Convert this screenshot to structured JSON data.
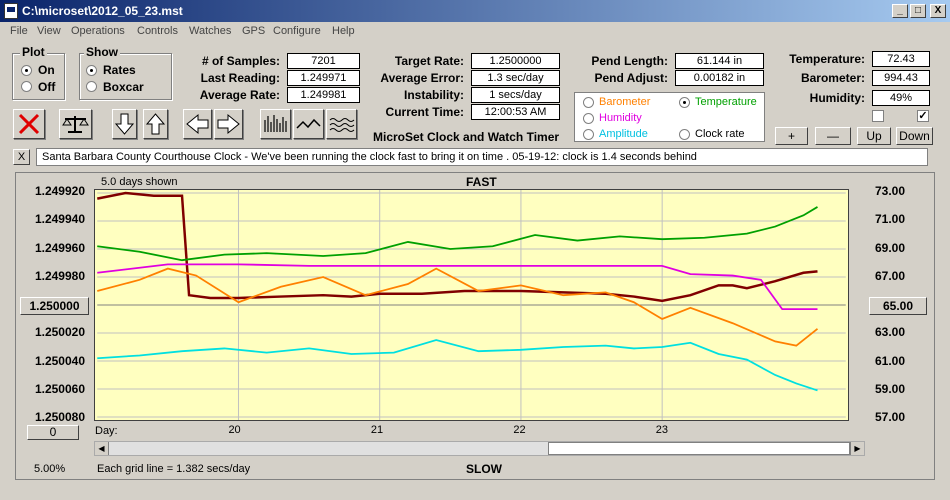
{
  "title": "C:\\microset\\2012_05_23.mst",
  "window_controls": {
    "minimize": "_",
    "maximize": "□",
    "close": "X"
  },
  "menu": [
    "File",
    "View",
    "Operations",
    "Controls",
    "Watches",
    "GPS",
    "Configure",
    "Help"
  ],
  "plot_group": {
    "label": "Plot",
    "on": "On",
    "off": "Off",
    "selected": "On"
  },
  "show_group": {
    "label": "Show",
    "rates": "Rates",
    "boxcar": "Boxcar",
    "selected": "Rates"
  },
  "stats": {
    "samples_label": "# of Samples:",
    "samples": "7201",
    "last_reading_label": "Last Reading:",
    "last_reading": "1.249971",
    "average_rate_label": "Average Rate:",
    "average_rate": "1.249981",
    "target_rate_label": "Target Rate:",
    "target_rate": "1.2500000",
    "average_error_label": "Average Error:",
    "average_error": "1.3 sec/day",
    "instability_label": "Instability:",
    "instability": "1 secs/day",
    "current_time_label": "Current Time:",
    "current_time": "12:00:53 AM",
    "pend_length_label": "Pend Length:",
    "pend_length": "61.144 in",
    "pend_adjust_label": "Pend Adjust:",
    "pend_adjust": "0.00182 in",
    "temperature_label": "Temperature:",
    "temperature": "72.43",
    "barometer_label": "Barometer:",
    "barometer": "994.43",
    "humidity_label": "Humidity:",
    "humidity": "49%"
  },
  "app_name": "MicroSet Clock and Watch Timer",
  "select_options": {
    "barometer": "Barometer",
    "temperature": "Temperature",
    "humidity": "Humidity",
    "amplitude": "Amplitude",
    "clock_rate": "Clock rate",
    "selected": "Temperature"
  },
  "right_buttons": {
    "plus": "+",
    "minus": "—",
    "up": "Up",
    "down": "Down"
  },
  "checkboxes": {
    "left": false,
    "right": true
  },
  "note": {
    "close": "X",
    "text": "Santa Barbara County Courthouse Clock - We've been running the clock fast to bring it on time .   05-19-12: clock is 1.4 seconds behind"
  },
  "graph": {
    "days_shown": "5.0 days shown",
    "top_label": "FAST",
    "bottom_label": "SLOW",
    "grid_note": "Each grid line = 1.382 secs/day",
    "percent": "5.00%",
    "left_center_button": "1.250000",
    "right_center_button": "65.00",
    "zero_button": "0",
    "day_label": "Day:"
  },
  "chart_data": {
    "type": "line",
    "title": "",
    "ylabel_left": "",
    "ylabel_right": "",
    "ylim_left": [
      1.25008,
      1.24992
    ],
    "ylim_right": [
      57.0,
      73.0
    ],
    "y_left_ticks": [
      "1.249920",
      "1.249940",
      "1.249960",
      "1.249980",
      "1.250000",
      "1.250020",
      "1.250040",
      "1.250060",
      "1.250080"
    ],
    "y_right_ticks": [
      "73.00",
      "71.00",
      "69.00",
      "67.00",
      "65.00",
      "63.00",
      "61.00",
      "59.00",
      "57.00"
    ],
    "x_ticks": [
      {
        "day": 20,
        "pos": 1.0
      },
      {
        "day": 21,
        "pos": 2.0
      },
      {
        "day": 22,
        "pos": 3.0
      },
      {
        "day": 23,
        "pos": 4.0
      }
    ],
    "xlim": [
      0.0,
      5.3
    ],
    "colors": {
      "rate": "#800000",
      "temperature": "#00a000",
      "humidity": "#e000e0",
      "barometer": "#ff8000",
      "amplitude": "#00e0e0"
    },
    "series": [
      {
        "name": "Clock rate",
        "color": "#800000",
        "axis": "left",
        "x": [
          0.0,
          0.2,
          0.4,
          0.6,
          0.62,
          0.65,
          0.8,
          1.0,
          1.3,
          1.6,
          1.8,
          2.0,
          2.3,
          2.6,
          3.0,
          3.3,
          3.6,
          3.8,
          4.0,
          4.2,
          4.4,
          4.5,
          4.6,
          4.8,
          5.0,
          5.1
        ],
        "y": [
          1.249924,
          1.24992,
          1.249922,
          1.249922,
          1.24995,
          1.249993,
          1.249995,
          1.249995,
          1.249994,
          1.249993,
          1.249994,
          1.249992,
          1.249992,
          1.24999,
          1.24999,
          1.249991,
          1.249992,
          1.249994,
          1.249997,
          1.249993,
          1.249986,
          1.249986,
          1.249988,
          1.249983,
          1.249977,
          1.249976
        ]
      },
      {
        "name": "Temperature",
        "color": "#00a000",
        "axis": "right",
        "x": [
          0.0,
          0.3,
          0.6,
          0.9,
          1.2,
          1.6,
          1.9,
          2.2,
          2.5,
          2.8,
          3.1,
          3.4,
          3.7,
          4.0,
          4.3,
          4.6,
          4.8,
          5.0,
          5.1
        ],
        "y": [
          69.2,
          68.8,
          68.2,
          68.6,
          68.7,
          68.5,
          68.7,
          69.5,
          69.0,
          69.2,
          70.0,
          69.6,
          69.9,
          69.7,
          69.8,
          70.1,
          70.6,
          71.4,
          72.0
        ]
      },
      {
        "name": "Humidity",
        "color": "#e000e0",
        "axis": "right",
        "x": [
          0.0,
          0.5,
          1.0,
          1.5,
          2.0,
          2.5,
          3.0,
          3.5,
          4.0,
          4.2,
          4.5,
          4.7,
          4.85,
          5.0,
          5.1
        ],
        "y": [
          67.3,
          67.9,
          67.9,
          67.8,
          67.8,
          67.8,
          67.8,
          67.8,
          67.8,
          67.2,
          67.1,
          66.8,
          64.7,
          64.7,
          64.7
        ]
      },
      {
        "name": "Barometer",
        "color": "#ff8000",
        "axis": "right",
        "x": [
          0.0,
          0.3,
          0.5,
          0.7,
          1.0,
          1.3,
          1.6,
          1.9,
          2.2,
          2.4,
          2.7,
          3.0,
          3.3,
          3.6,
          3.8,
          4.0,
          4.2,
          4.5,
          4.8,
          4.95,
          5.1
        ],
        "y": [
          66.0,
          66.8,
          67.6,
          67.1,
          65.2,
          66.3,
          67.0,
          65.7,
          66.5,
          67.6,
          66.0,
          66.4,
          65.7,
          65.9,
          65.2,
          64.0,
          64.8,
          63.7,
          62.4,
          62.1,
          63.3
        ]
      },
      {
        "name": "Amplitude",
        "color": "#00e0e0",
        "axis": "right",
        "x": [
          0.0,
          0.3,
          0.6,
          0.9,
          1.2,
          1.5,
          1.8,
          2.1,
          2.4,
          2.7,
          3.0,
          3.3,
          3.6,
          3.8,
          4.0,
          4.2,
          4.4,
          4.6,
          4.8,
          4.95,
          5.1
        ],
        "y": [
          61.2,
          61.4,
          61.7,
          61.9,
          61.6,
          61.9,
          61.5,
          61.6,
          62.5,
          61.7,
          61.8,
          62.0,
          62.1,
          61.9,
          62.0,
          62.3,
          61.5,
          61.1,
          60.0,
          59.4,
          58.9
        ]
      }
    ]
  }
}
